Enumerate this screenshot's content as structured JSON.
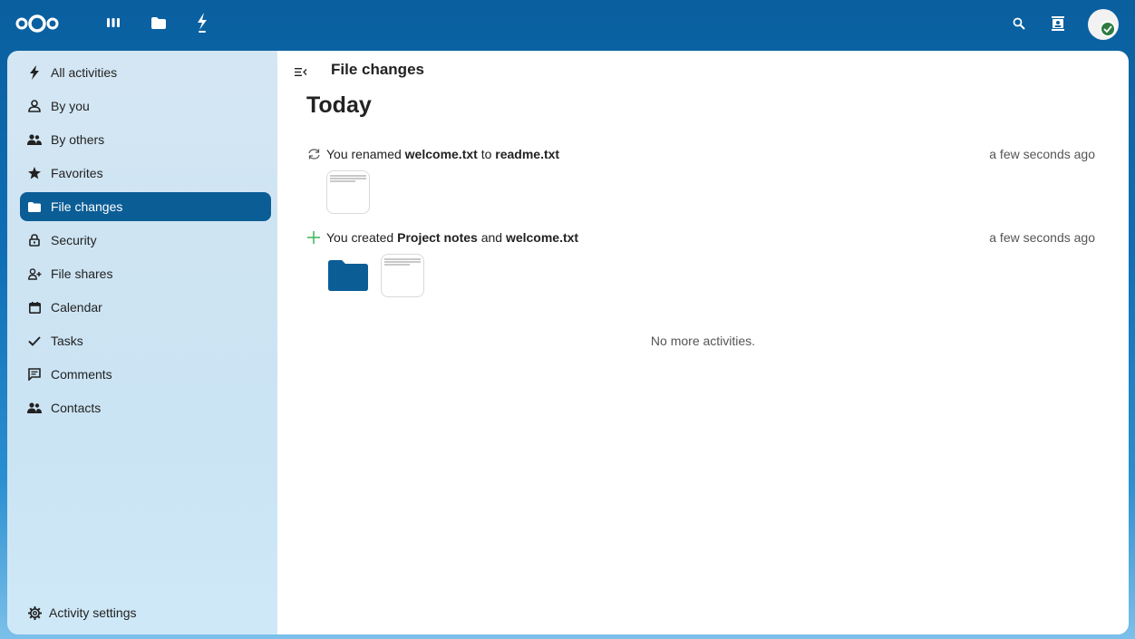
{
  "header": {
    "icons": [
      "nextcloud-logo",
      "dashboard-icon",
      "files-icon",
      "activity-icon",
      "search-icon",
      "contacts-icon",
      "user-avatar"
    ],
    "colors": {
      "bar": "#0b5d96",
      "accent": "#0b5d96"
    }
  },
  "sidebar": {
    "items": [
      {
        "label": "All activities",
        "icon": "bolt-icon"
      },
      {
        "label": "By you",
        "icon": "user-icon"
      },
      {
        "label": "By others",
        "icon": "users-icon"
      },
      {
        "label": "Favorites",
        "icon": "star-icon"
      },
      {
        "label": "File changes",
        "icon": "folder-icon",
        "active": true
      },
      {
        "label": "Security",
        "icon": "lock-icon"
      },
      {
        "label": "File shares",
        "icon": "share-user-icon"
      },
      {
        "label": "Calendar",
        "icon": "calendar-icon"
      },
      {
        "label": "Tasks",
        "icon": "check-icon"
      },
      {
        "label": "Comments",
        "icon": "comment-icon"
      },
      {
        "label": "Contacts",
        "icon": "contacts-group-icon"
      }
    ],
    "settings_label": "Activity settings"
  },
  "main": {
    "title": "File changes",
    "day": "Today",
    "activities": [
      {
        "icon": "rename-icon",
        "prefix": "You renamed ",
        "file1": "welcome.txt",
        "middle": " to ",
        "file2": "readme.txt",
        "time": "a few seconds ago"
      },
      {
        "icon": "add-icon",
        "prefix": "You created ",
        "file1": "Project notes",
        "middle": " and ",
        "file2": "welcome.txt",
        "time": "a few seconds ago"
      }
    ],
    "no_more": "No more activities."
  }
}
